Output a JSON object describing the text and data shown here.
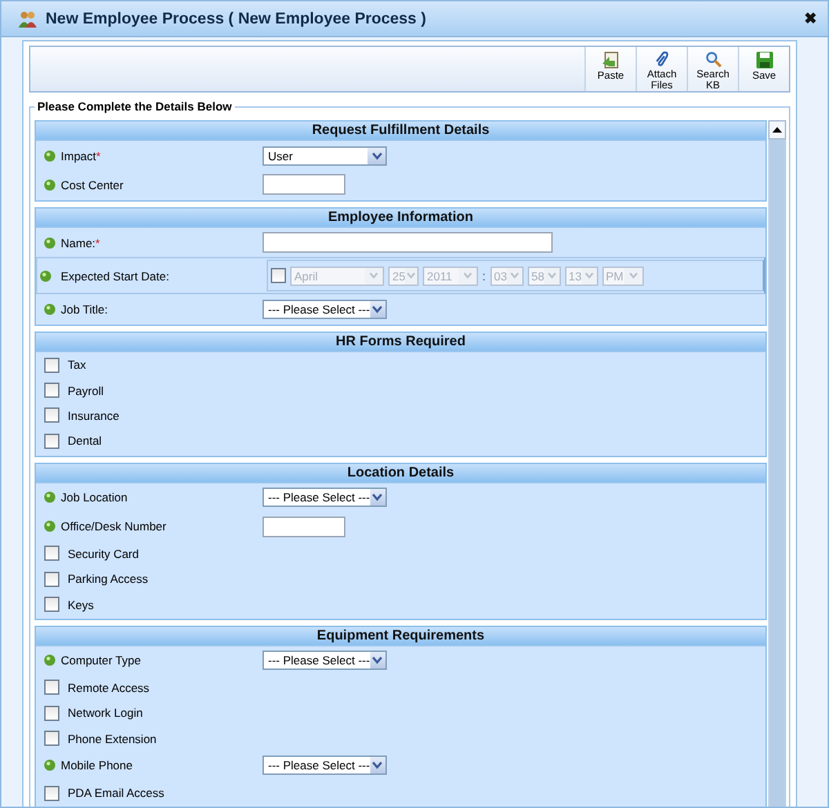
{
  "window": {
    "title": "New Employee Process ( New Employee Process )",
    "close": "✖"
  },
  "toolbar": [
    {
      "kind": "paste",
      "label": "Paste"
    },
    {
      "kind": "attach",
      "label": "Attach Files"
    },
    {
      "kind": "search",
      "label": "Search KB"
    },
    {
      "kind": "save",
      "label": "Save"
    }
  ],
  "form": {
    "legend": "Please Complete the Details Below",
    "sections": [
      {
        "title": "Request Fulfillment Details",
        "rows": [
          {
            "kind": "select",
            "label": "Impact",
            "required_mark": "*",
            "value": "User"
          },
          {
            "kind": "text",
            "label": "Cost Center"
          }
        ]
      },
      {
        "title": "Employee Information",
        "rows": [
          {
            "kind": "text",
            "label": "Name:",
            "required_mark": "*",
            "wide": true
          },
          {
            "kind": "date",
            "label": "Expected Start Date:",
            "checked": false,
            "disabled": true,
            "separator": ":",
            "parts": [
              "April",
              "25",
              "2011",
              "03",
              "58",
              "13",
              "PM"
            ]
          },
          {
            "kind": "select",
            "label": "Job Title:",
            "value": "--- Please Select ---"
          }
        ]
      },
      {
        "title": "HR Forms Required",
        "rows": [
          {
            "kind": "check",
            "label": "Tax",
            "checked": false
          },
          {
            "kind": "check",
            "label": "Payroll",
            "checked": false
          },
          {
            "kind": "check",
            "label": "Insurance",
            "checked": false
          },
          {
            "kind": "check",
            "label": "Dental",
            "checked": false
          }
        ]
      },
      {
        "title": "Location Details",
        "rows": [
          {
            "kind": "select",
            "label": "Job Location",
            "value": "--- Please Select ---"
          },
          {
            "kind": "text",
            "label": "Office/Desk Number"
          },
          {
            "kind": "check",
            "label": "Security Card",
            "checked": false
          },
          {
            "kind": "check",
            "label": "Parking Access",
            "checked": false
          },
          {
            "kind": "check",
            "label": "Keys",
            "checked": false
          }
        ]
      },
      {
        "title": "Equipment Requirements",
        "rows": [
          {
            "kind": "select",
            "label": "Computer Type",
            "value": "--- Please Select ---"
          },
          {
            "kind": "check",
            "label": "Remote Access",
            "checked": false
          },
          {
            "kind": "check",
            "label": "Network Login",
            "checked": false
          },
          {
            "kind": "check",
            "label": "Phone Extension",
            "checked": false
          },
          {
            "kind": "select",
            "label": "Mobile Phone",
            "value": "--- Please Select ---"
          },
          {
            "kind": "check",
            "label": "PDA Email Access",
            "checked": false
          }
        ]
      }
    ]
  }
}
